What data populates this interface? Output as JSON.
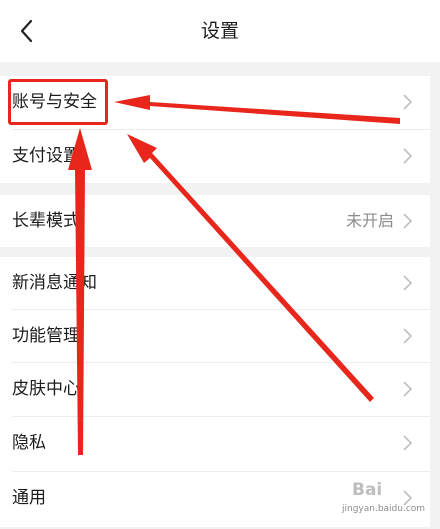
{
  "header": {
    "title": "设置",
    "back_icon": "back-chevron-icon"
  },
  "rows": [
    {
      "label": "账号与安全",
      "value": ""
    },
    {
      "label": "支付设置",
      "value": ""
    },
    {
      "label": "长辈模式",
      "value": "未开启"
    },
    {
      "label": "新消息通知",
      "value": ""
    },
    {
      "label": "功能管理",
      "value": ""
    },
    {
      "label": "皮肤中心",
      "value": ""
    },
    {
      "label": "隐私",
      "value": ""
    },
    {
      "label": "通用",
      "value": ""
    }
  ],
  "annotation": {
    "highlight_color": "#e8261b"
  },
  "watermark": {
    "text": "Bai",
    "url": "jingyan.baidu.com"
  },
  "colors": {
    "background": "#f2f2f2",
    "row_background": "#ffffff",
    "text": "#1c1c1c",
    "secondary_text": "#8c8c8c"
  }
}
